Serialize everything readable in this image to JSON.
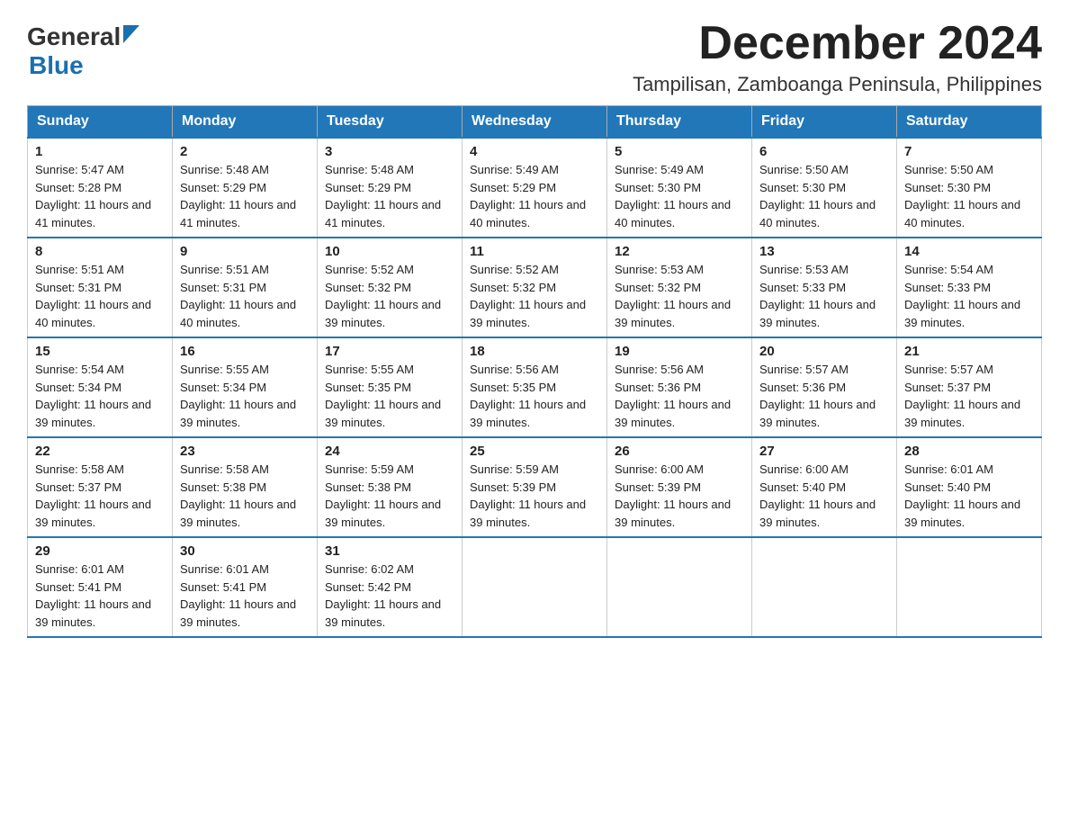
{
  "header": {
    "logo": {
      "general_text": "General",
      "blue_text": "Blue"
    },
    "month_year": "December 2024",
    "location": "Tampilisan, Zamboanga Peninsula, Philippines"
  },
  "calendar": {
    "days_of_week": [
      "Sunday",
      "Monday",
      "Tuesday",
      "Wednesday",
      "Thursday",
      "Friday",
      "Saturday"
    ],
    "weeks": [
      [
        {
          "day": "1",
          "sunrise": "5:47 AM",
          "sunset": "5:28 PM",
          "daylight": "11 hours and 41 minutes."
        },
        {
          "day": "2",
          "sunrise": "5:48 AM",
          "sunset": "5:29 PM",
          "daylight": "11 hours and 41 minutes."
        },
        {
          "day": "3",
          "sunrise": "5:48 AM",
          "sunset": "5:29 PM",
          "daylight": "11 hours and 41 minutes."
        },
        {
          "day": "4",
          "sunrise": "5:49 AM",
          "sunset": "5:29 PM",
          "daylight": "11 hours and 40 minutes."
        },
        {
          "day": "5",
          "sunrise": "5:49 AM",
          "sunset": "5:30 PM",
          "daylight": "11 hours and 40 minutes."
        },
        {
          "day": "6",
          "sunrise": "5:50 AM",
          "sunset": "5:30 PM",
          "daylight": "11 hours and 40 minutes."
        },
        {
          "day": "7",
          "sunrise": "5:50 AM",
          "sunset": "5:30 PM",
          "daylight": "11 hours and 40 minutes."
        }
      ],
      [
        {
          "day": "8",
          "sunrise": "5:51 AM",
          "sunset": "5:31 PM",
          "daylight": "11 hours and 40 minutes."
        },
        {
          "day": "9",
          "sunrise": "5:51 AM",
          "sunset": "5:31 PM",
          "daylight": "11 hours and 40 minutes."
        },
        {
          "day": "10",
          "sunrise": "5:52 AM",
          "sunset": "5:32 PM",
          "daylight": "11 hours and 39 minutes."
        },
        {
          "day": "11",
          "sunrise": "5:52 AM",
          "sunset": "5:32 PM",
          "daylight": "11 hours and 39 minutes."
        },
        {
          "day": "12",
          "sunrise": "5:53 AM",
          "sunset": "5:32 PM",
          "daylight": "11 hours and 39 minutes."
        },
        {
          "day": "13",
          "sunrise": "5:53 AM",
          "sunset": "5:33 PM",
          "daylight": "11 hours and 39 minutes."
        },
        {
          "day": "14",
          "sunrise": "5:54 AM",
          "sunset": "5:33 PM",
          "daylight": "11 hours and 39 minutes."
        }
      ],
      [
        {
          "day": "15",
          "sunrise": "5:54 AM",
          "sunset": "5:34 PM",
          "daylight": "11 hours and 39 minutes."
        },
        {
          "day": "16",
          "sunrise": "5:55 AM",
          "sunset": "5:34 PM",
          "daylight": "11 hours and 39 minutes."
        },
        {
          "day": "17",
          "sunrise": "5:55 AM",
          "sunset": "5:35 PM",
          "daylight": "11 hours and 39 minutes."
        },
        {
          "day": "18",
          "sunrise": "5:56 AM",
          "sunset": "5:35 PM",
          "daylight": "11 hours and 39 minutes."
        },
        {
          "day": "19",
          "sunrise": "5:56 AM",
          "sunset": "5:36 PM",
          "daylight": "11 hours and 39 minutes."
        },
        {
          "day": "20",
          "sunrise": "5:57 AM",
          "sunset": "5:36 PM",
          "daylight": "11 hours and 39 minutes."
        },
        {
          "day": "21",
          "sunrise": "5:57 AM",
          "sunset": "5:37 PM",
          "daylight": "11 hours and 39 minutes."
        }
      ],
      [
        {
          "day": "22",
          "sunrise": "5:58 AM",
          "sunset": "5:37 PM",
          "daylight": "11 hours and 39 minutes."
        },
        {
          "day": "23",
          "sunrise": "5:58 AM",
          "sunset": "5:38 PM",
          "daylight": "11 hours and 39 minutes."
        },
        {
          "day": "24",
          "sunrise": "5:59 AM",
          "sunset": "5:38 PM",
          "daylight": "11 hours and 39 minutes."
        },
        {
          "day": "25",
          "sunrise": "5:59 AM",
          "sunset": "5:39 PM",
          "daylight": "11 hours and 39 minutes."
        },
        {
          "day": "26",
          "sunrise": "6:00 AM",
          "sunset": "5:39 PM",
          "daylight": "11 hours and 39 minutes."
        },
        {
          "day": "27",
          "sunrise": "6:00 AM",
          "sunset": "5:40 PM",
          "daylight": "11 hours and 39 minutes."
        },
        {
          "day": "28",
          "sunrise": "6:01 AM",
          "sunset": "5:40 PM",
          "daylight": "11 hours and 39 minutes."
        }
      ],
      [
        {
          "day": "29",
          "sunrise": "6:01 AM",
          "sunset": "5:41 PM",
          "daylight": "11 hours and 39 minutes."
        },
        {
          "day": "30",
          "sunrise": "6:01 AM",
          "sunset": "5:41 PM",
          "daylight": "11 hours and 39 minutes."
        },
        {
          "day": "31",
          "sunrise": "6:02 AM",
          "sunset": "5:42 PM",
          "daylight": "11 hours and 39 minutes."
        },
        null,
        null,
        null,
        null
      ]
    ]
  }
}
